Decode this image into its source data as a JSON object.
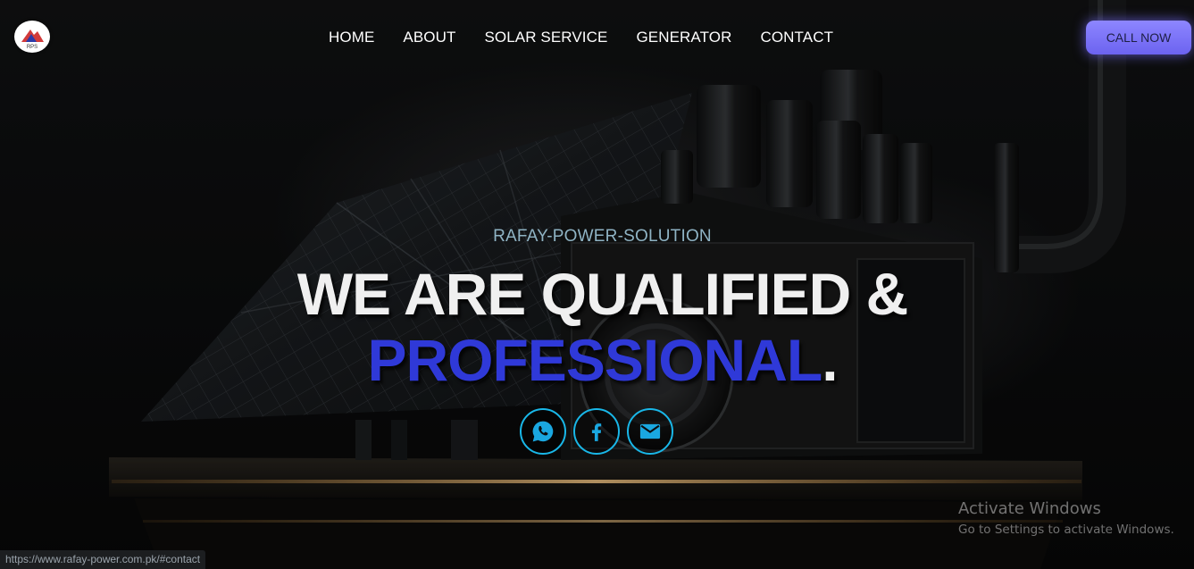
{
  "header": {
    "logo_text": "RPS",
    "nav": [
      {
        "label": "HOME"
      },
      {
        "label": "ABOUT"
      },
      {
        "label": "SOLAR SERVICE"
      },
      {
        "label": "GENERATOR"
      },
      {
        "label": "CONTACT"
      }
    ],
    "cta_label": "CALL NOW"
  },
  "hero": {
    "eyebrow": "RAFAY-POWER-SOLUTION",
    "headline_line1": "WE ARE QUALIFIED &",
    "headline_line2": "PROFESSIONAL",
    "headline_line2_suffix": ".",
    "socials": [
      {
        "icon": "whatsapp-icon"
      },
      {
        "icon": "facebook-icon"
      },
      {
        "icon": "mail-icon"
      }
    ]
  },
  "watermark": {
    "title": "Activate Windows",
    "subtitle": "Go to Settings to activate Windows."
  },
  "status_bar": {
    "url": "https://www.rafay-power.com.pk/#contact"
  },
  "colors": {
    "accent_blue": "#2f39d8",
    "cta": "#7b74fa",
    "social_ring": "#19b7e8",
    "eyebrow": "#8fb3c4"
  }
}
